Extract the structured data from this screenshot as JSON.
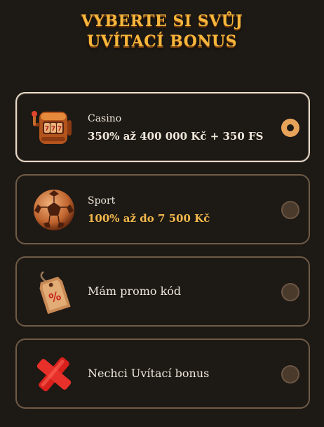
{
  "header": {
    "title_line1": "VYBERTE SI SVŮJ",
    "title_line2": "UVÍTACÍ BONUS"
  },
  "options": [
    {
      "icon": "slot-machine-icon",
      "label": "Casino",
      "amount": "350% až 400 000 Kč + 350 FS",
      "selected": true
    },
    {
      "icon": "soccer-ball-icon",
      "label": "Sport",
      "amount": "100% až do 7 500 Kč",
      "selected": false
    },
    {
      "icon": "price-tag-icon",
      "label": "Mám promo kód",
      "selected": false
    },
    {
      "icon": "red-cross-icon",
      "label": "Nechci Uvítací bonus",
      "selected": false
    }
  ],
  "colors": {
    "accent": "#f6b63c",
    "amount_selected": "#efe7db",
    "amount": "#f2b84b",
    "background": "#1d1915"
  }
}
